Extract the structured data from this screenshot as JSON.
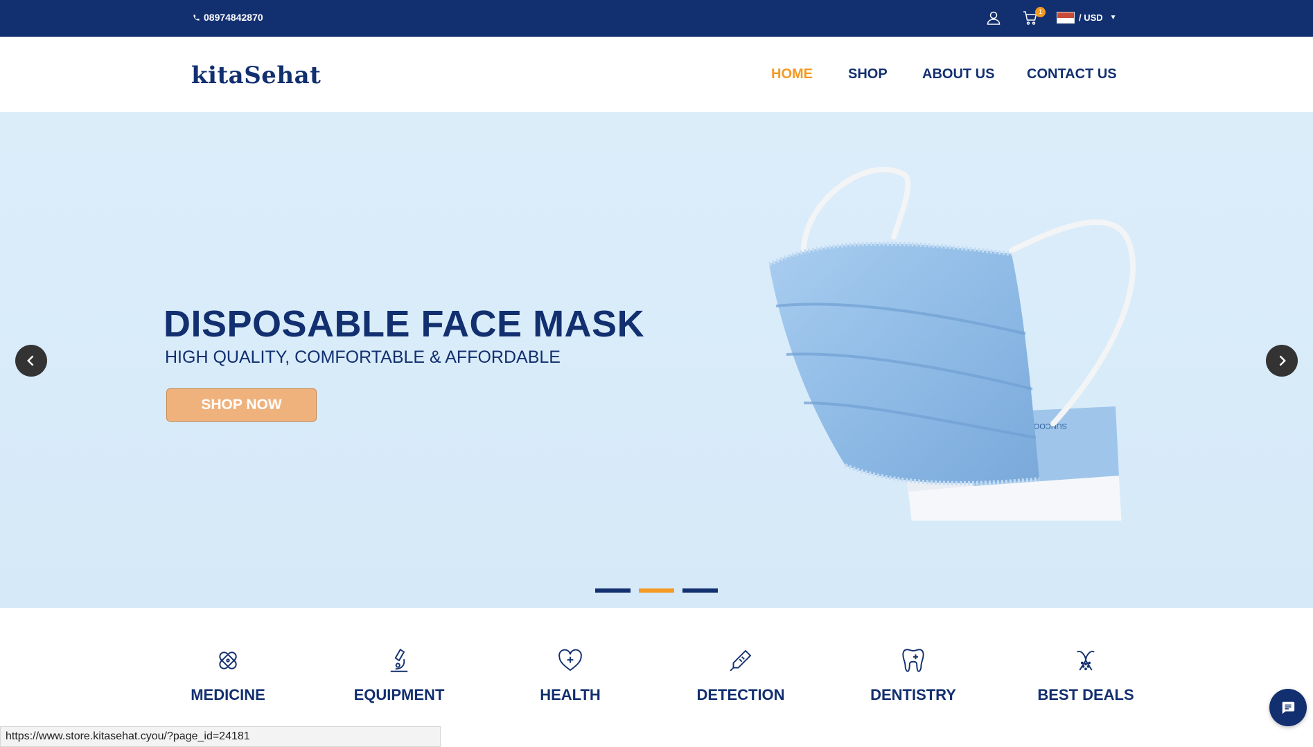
{
  "topbar": {
    "phone": "08974842870",
    "cart_count": "1",
    "currency": "/ USD"
  },
  "header": {
    "logo": "kitaSehat",
    "nav": [
      {
        "label": "HOME"
      },
      {
        "label": "SHOP"
      },
      {
        "label": "ABOUT US"
      },
      {
        "label": "CONTACT US"
      }
    ]
  },
  "hero": {
    "title": "DISPOSABLE FACE MASK",
    "subtitle": "HIGH QUALITY, COMFORTABLE & AFFORDABLE",
    "button": "SHOP NOW",
    "active_slide": 2,
    "slide_count": 3
  },
  "categories": [
    {
      "label": "MEDICINE",
      "icon": "bandage-icon"
    },
    {
      "label": "EQUIPMENT",
      "icon": "microscope-icon"
    },
    {
      "label": "HEALTH",
      "icon": "heart-plus-icon"
    },
    {
      "label": "DETECTION",
      "icon": "thermometer-icon"
    },
    {
      "label": "DENTISTRY",
      "icon": "tooth-icon"
    },
    {
      "label": "BEST DEALS",
      "icon": "ribbon-icon"
    }
  ],
  "status_bar": {
    "url": "https://www.store.kitasehat.cyou/?page_id=24181"
  },
  "colors": {
    "brand_navy": "#122f6f",
    "accent_orange": "#f39a23",
    "button_peach": "#f0b27c",
    "hero_bg": "#dcedfa"
  }
}
